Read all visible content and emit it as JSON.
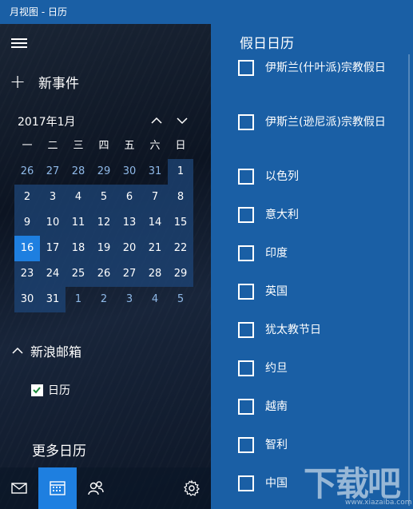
{
  "window": {
    "title": "月视图 - 日历"
  },
  "sidebar": {
    "new_event_label": "新事件",
    "month_label": "2017年1月",
    "weekdays": [
      "一",
      "二",
      "三",
      "四",
      "五",
      "六",
      "日"
    ],
    "days": [
      {
        "d": "26",
        "m": "other"
      },
      {
        "d": "27",
        "m": "other"
      },
      {
        "d": "28",
        "m": "other"
      },
      {
        "d": "29",
        "m": "other"
      },
      {
        "d": "30",
        "m": "other"
      },
      {
        "d": "31",
        "m": "other"
      },
      {
        "d": "1",
        "m": "in"
      },
      {
        "d": "2",
        "m": "in"
      },
      {
        "d": "3",
        "m": "in"
      },
      {
        "d": "4",
        "m": "in"
      },
      {
        "d": "5",
        "m": "in"
      },
      {
        "d": "6",
        "m": "in"
      },
      {
        "d": "7",
        "m": "in"
      },
      {
        "d": "8",
        "m": "in"
      },
      {
        "d": "9",
        "m": "in"
      },
      {
        "d": "10",
        "m": "in"
      },
      {
        "d": "11",
        "m": "in"
      },
      {
        "d": "12",
        "m": "in"
      },
      {
        "d": "13",
        "m": "in"
      },
      {
        "d": "14",
        "m": "in"
      },
      {
        "d": "15",
        "m": "in"
      },
      {
        "d": "16",
        "m": "today"
      },
      {
        "d": "17",
        "m": "in"
      },
      {
        "d": "18",
        "m": "in"
      },
      {
        "d": "19",
        "m": "in"
      },
      {
        "d": "20",
        "m": "in"
      },
      {
        "d": "21",
        "m": "in"
      },
      {
        "d": "22",
        "m": "in"
      },
      {
        "d": "23",
        "m": "in"
      },
      {
        "d": "24",
        "m": "in"
      },
      {
        "d": "25",
        "m": "in"
      },
      {
        "d": "26",
        "m": "in"
      },
      {
        "d": "27",
        "m": "in"
      },
      {
        "d": "28",
        "m": "in"
      },
      {
        "d": "29",
        "m": "in"
      },
      {
        "d": "30",
        "m": "in"
      },
      {
        "d": "31",
        "m": "in"
      },
      {
        "d": "1",
        "m": "other"
      },
      {
        "d": "2",
        "m": "other"
      },
      {
        "d": "3",
        "m": "other"
      },
      {
        "d": "4",
        "m": "other"
      },
      {
        "d": "5",
        "m": "other"
      }
    ],
    "account_label": "新浪邮箱",
    "calendar_item_label": "日历",
    "more_calendars_label": "更多日历"
  },
  "holiday_panel": {
    "title": "假日日历",
    "items": [
      {
        "label": "伊斯兰(什叶派)宗教假日",
        "checked": false
      },
      {
        "label": "伊斯兰(逊尼派)宗教假日",
        "checked": false
      },
      {
        "label": "以色列",
        "checked": false
      },
      {
        "label": "意大利",
        "checked": false
      },
      {
        "label": "印度",
        "checked": false
      },
      {
        "label": "英国",
        "checked": false
      },
      {
        "label": "犹太教节日",
        "checked": false
      },
      {
        "label": "约旦",
        "checked": false
      },
      {
        "label": "越南",
        "checked": false
      },
      {
        "label": "智利",
        "checked": false
      },
      {
        "label": "中国",
        "checked": false
      }
    ]
  },
  "watermark": {
    "text": "下载吧",
    "sub": "www.xiazaiba.com"
  },
  "colors": {
    "accent": "#1e7fe0",
    "panel": "#1a5fa5"
  }
}
